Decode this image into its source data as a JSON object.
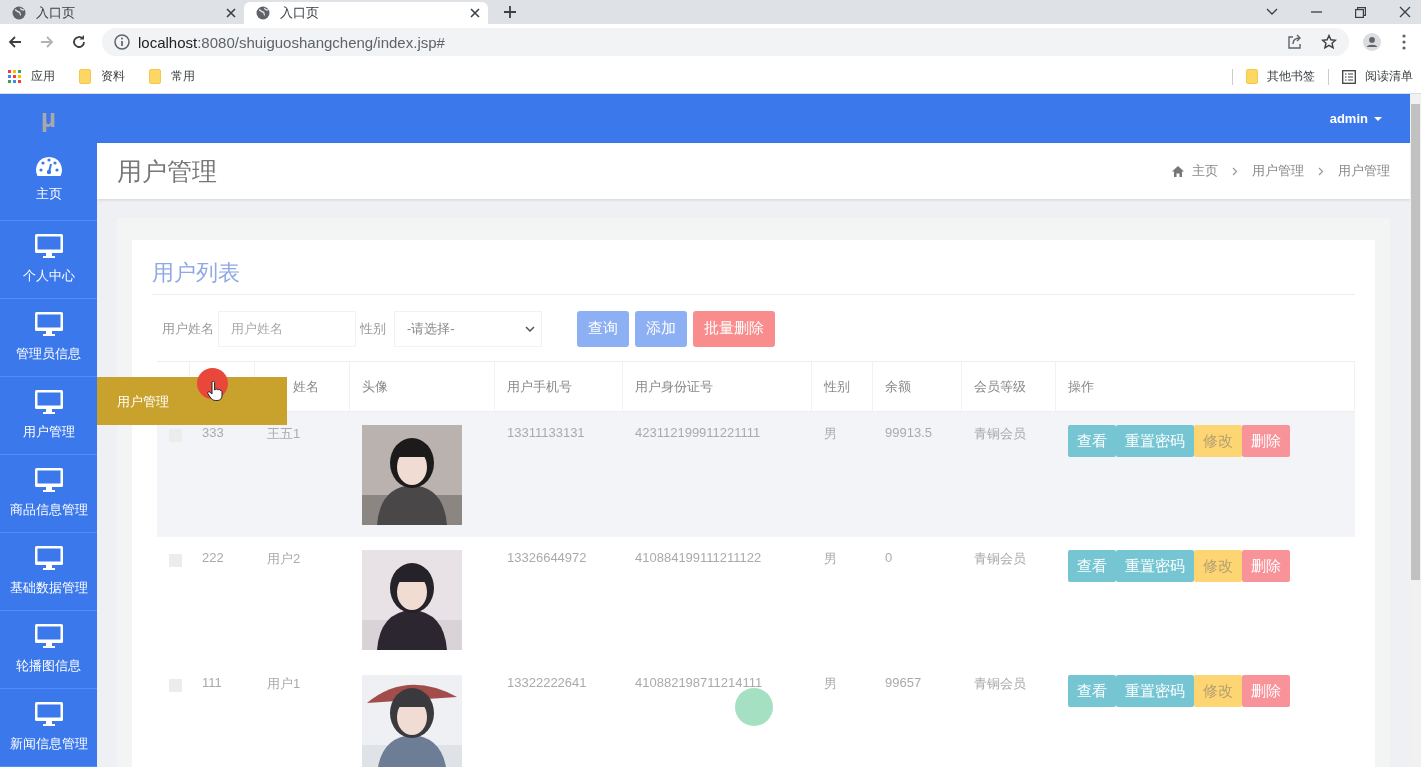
{
  "browser": {
    "tabs": [
      {
        "title": "入口页",
        "selected": false
      },
      {
        "title": "入口页",
        "selected": true
      }
    ],
    "url_host": "localhost",
    "url_rest": ":8080/shuiguoshangcheng/index.jsp#",
    "bookmarks": [
      {
        "label": "应用",
        "kind": "apps"
      },
      {
        "label": "资料",
        "kind": "folder"
      },
      {
        "label": "常用",
        "kind": "folder"
      }
    ],
    "bookmarks_right": [
      {
        "label": "其他书签",
        "kind": "folder"
      },
      {
        "label": "阅读清单",
        "kind": "list"
      }
    ]
  },
  "app": {
    "logo": "µ",
    "user": "admin",
    "sidebar": [
      {
        "label": "主页",
        "kind": "gauge"
      },
      {
        "label": "个人中心",
        "kind": "monitor"
      },
      {
        "label": "管理员信息",
        "kind": "monitor"
      },
      {
        "label": "用户管理",
        "kind": "monitor",
        "flyout": "用户管理"
      },
      {
        "label": "商品信息管理",
        "kind": "monitor"
      },
      {
        "label": "基础数据管理",
        "kind": "monitor"
      },
      {
        "label": "轮播图信息",
        "kind": "monitor"
      },
      {
        "label": "新闻信息管理",
        "kind": "monitor"
      }
    ],
    "page_title": "用户管理",
    "breadcrumb": [
      "主页",
      "用户管理",
      "用户管理"
    ],
    "card_title": "用户列表",
    "search": {
      "name_label": "用户姓名",
      "name_placeholder": "用户姓名",
      "gender_label": "性别",
      "gender_value": "-请选择-"
    },
    "buttons": [
      {
        "label": "查询",
        "kind": "primary"
      },
      {
        "label": "添加",
        "kind": "primary"
      },
      {
        "label": "批量删除",
        "kind": "danger"
      }
    ],
    "columns": [
      "",
      "",
      "姓名",
      "头像",
      "用户手机号",
      "用户身份证号",
      "性别",
      "余额",
      "会员等级",
      "操作"
    ],
    "rows": [
      {
        "id": "333",
        "name": "王五1",
        "phone": "13311133131",
        "id_number": "423112199911221111",
        "gender": "男",
        "balance": "99913.5",
        "level": "青铜会员",
        "hovered": true,
        "actions": [
          {
            "label": "查看",
            "kind": "info"
          },
          {
            "label": "重置密码",
            "kind": "info"
          },
          {
            "label": "修改",
            "kind": "warning"
          },
          {
            "label": "删除",
            "kind": "danger"
          }
        ]
      },
      {
        "id": "222",
        "name": "用户2",
        "phone": "13326644972",
        "id_number": "410884199111211122",
        "gender": "男",
        "balance": "0",
        "level": "青铜会员",
        "hovered": false,
        "actions": [
          {
            "label": "查看",
            "kind": "info"
          },
          {
            "label": "重置密码",
            "kind": "info"
          },
          {
            "label": "修改",
            "kind": "warning"
          },
          {
            "label": "删除",
            "kind": "danger"
          }
        ]
      },
      {
        "id": "111",
        "name": "用户1",
        "phone": "13322222641",
        "id_number": "410882198711214111",
        "gender": "男",
        "balance": "99657",
        "level": "青铜会员",
        "hovered": false,
        "actions": [
          {
            "label": "查看",
            "kind": "info"
          },
          {
            "label": "重置密码",
            "kind": "info"
          },
          {
            "label": "修改",
            "kind": "warning"
          },
          {
            "label": "删除",
            "kind": "danger"
          }
        ]
      }
    ]
  }
}
